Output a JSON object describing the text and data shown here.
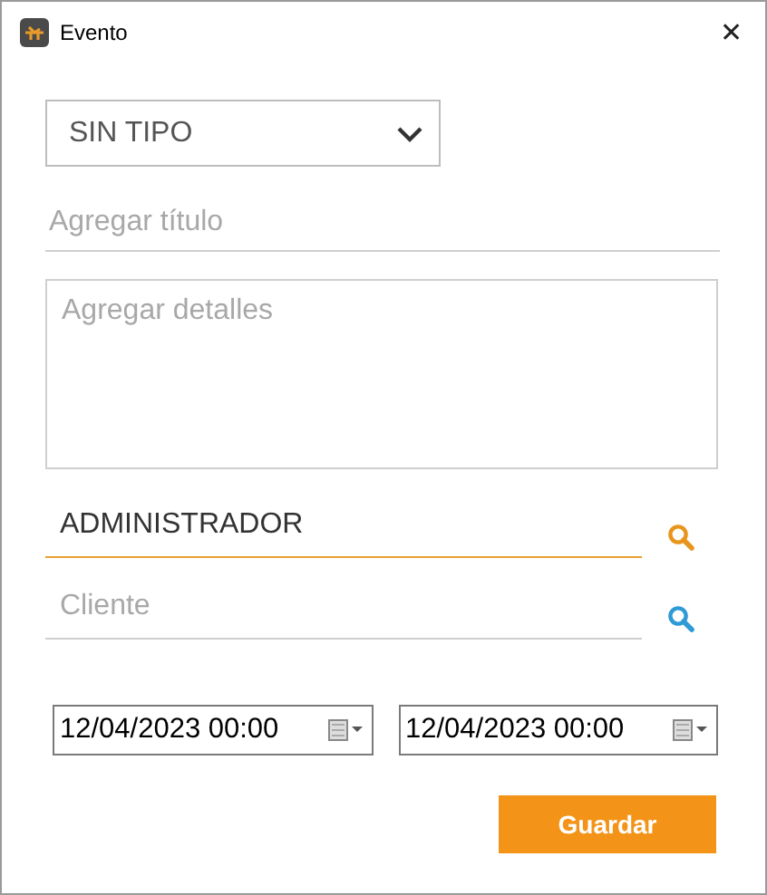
{
  "window": {
    "title": "Evento",
    "close": "✕"
  },
  "type_select": {
    "value": "SIN TIPO"
  },
  "title_field": {
    "placeholder": "Agregar título"
  },
  "details_field": {
    "placeholder": "Agregar detalles"
  },
  "lookups": [
    {
      "value": "ADMINISTRADOR",
      "focused": true
    },
    {
      "placeholder": "Cliente",
      "focused": false
    }
  ],
  "dates": [
    {
      "value": "12/04/2023 00:00"
    },
    {
      "value": "12/04/2023 00:00"
    }
  ],
  "save_button": "Guardar"
}
